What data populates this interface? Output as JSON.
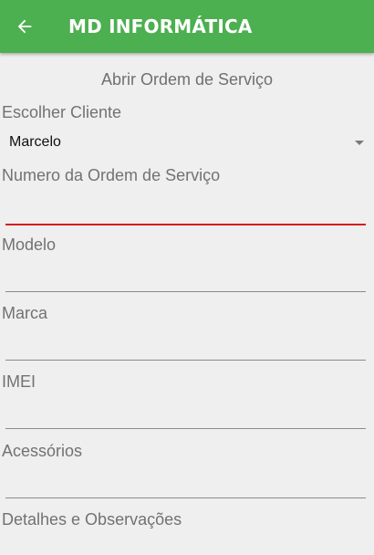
{
  "app_bar": {
    "title": "MD INFORMÁTICA",
    "back_icon": "arrow-left-icon",
    "background_color": "#4caf50"
  },
  "form": {
    "heading": "Abrir Ordem de Serviço",
    "client_label": "Escolher Cliente",
    "client_selected": "Marcelo",
    "order_number_label": "Numero da Ordem de Serviço",
    "order_number_value": "",
    "model_label": "Modelo",
    "model_value": "",
    "brand_label": "Marca",
    "brand_value": "",
    "imei_label": "IMEI",
    "imei_value": "",
    "accessories_label": "Acessórios",
    "accessories_value": "",
    "details_label": "Detalhes e Observações"
  },
  "colors": {
    "focus_underline": "#d81b1b",
    "inactive_underline": "#8a8a8a"
  }
}
